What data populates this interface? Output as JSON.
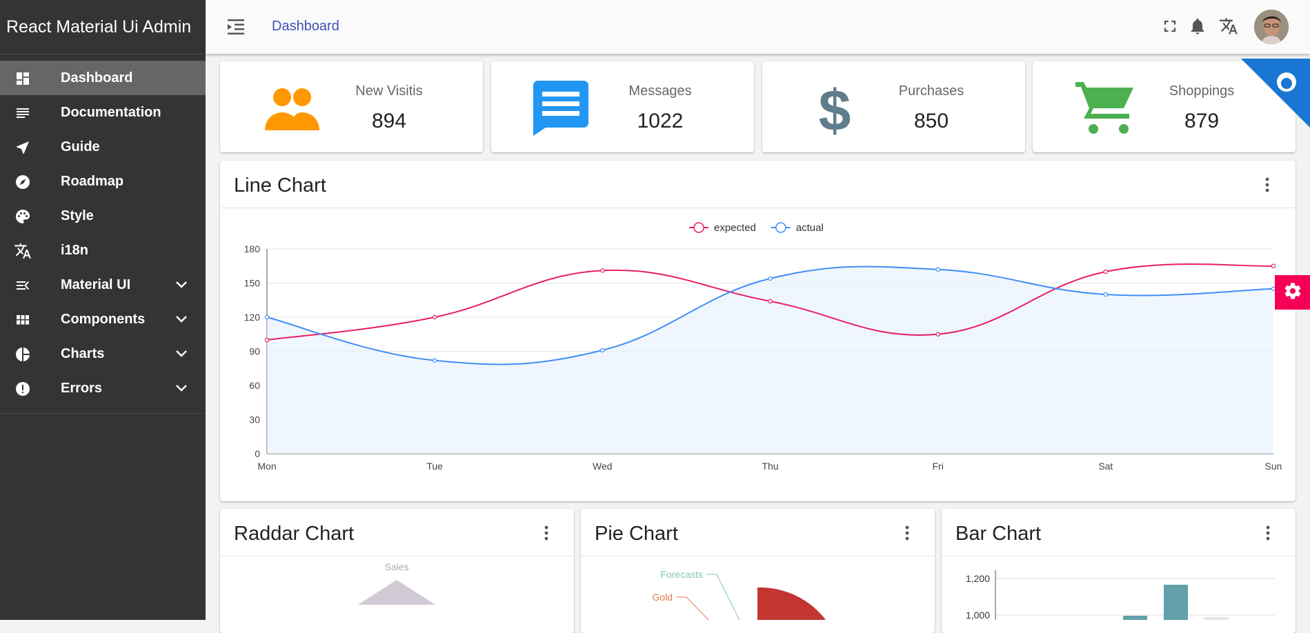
{
  "app": {
    "title": "React Material Ui Admin"
  },
  "header": {
    "breadcrumb": "Dashboard"
  },
  "sidebar": {
    "items": [
      {
        "label": "Dashboard",
        "icon": "dashboard-icon",
        "active": true
      },
      {
        "label": "Documentation",
        "icon": "notes-icon"
      },
      {
        "label": "Guide",
        "icon": "navigation-icon"
      },
      {
        "label": "Roadmap",
        "icon": "compass-icon"
      },
      {
        "label": "Style",
        "icon": "palette-icon"
      },
      {
        "label": "i18n",
        "icon": "translate-icon"
      },
      {
        "label": "Material UI",
        "icon": "menu-open-icon",
        "expandable": true
      },
      {
        "label": "Components",
        "icon": "grid-icon",
        "expandable": true
      },
      {
        "label": "Charts",
        "icon": "pie-icon",
        "expandable": true
      },
      {
        "label": "Errors",
        "icon": "error-icon",
        "expandable": true
      }
    ]
  },
  "stats": [
    {
      "title": "New Visitis",
      "value": "894",
      "icon": "people-icon",
      "color": "#ff9800"
    },
    {
      "title": "Messages",
      "value": "1022",
      "icon": "message-icon",
      "color": "#2196f3"
    },
    {
      "title": "Purchases",
      "value": "850",
      "icon": "dollar-icon",
      "color": "#607d8b"
    },
    {
      "title": "Shoppings",
      "value": "879",
      "icon": "cart-icon",
      "color": "#4caf50"
    }
  ],
  "cards": {
    "line": "Line Chart",
    "radar": "Raddar Chart",
    "pie": "Pie Chart",
    "bar": "Bar Chart"
  },
  "chart_data": [
    {
      "type": "line",
      "title": "Line Chart",
      "categories": [
        "Mon",
        "Tue",
        "Wed",
        "Thu",
        "Fri",
        "Sat",
        "Sun"
      ],
      "series": [
        {
          "name": "expected",
          "values": [
            100,
            120,
            161,
            134,
            105,
            160,
            165
          ],
          "color": "#e91e63"
        },
        {
          "name": "actual",
          "values": [
            120,
            82,
            91,
            154,
            162,
            140,
            145
          ],
          "color": "#3f8ef5",
          "area": true
        }
      ],
      "ylim": [
        0,
        180
      ],
      "yticks": [
        0,
        30,
        60,
        90,
        120,
        150,
        180
      ],
      "legend": "top-center",
      "grid": true
    },
    {
      "type": "radar",
      "title": "Raddar Chart",
      "visible_labels": [
        "Sales"
      ]
    },
    {
      "type": "pie",
      "title": "Pie Chart",
      "visible_labels": [
        {
          "label": "Forecasts",
          "color": "#7ec8a4"
        },
        {
          "label": "Gold",
          "color": "#e07b53"
        }
      ],
      "slice_color": "#c23531"
    },
    {
      "type": "bar",
      "title": "Bar Chart",
      "yticks": [
        "1,000",
        "1,200"
      ],
      "bar_color": "#61a0a8",
      "visible_values": [
        1000,
        1175,
        980
      ]
    }
  ],
  "colors": {
    "accent": "#3f51b5",
    "fab": "#f50057",
    "ribbon": "#1976d2"
  }
}
